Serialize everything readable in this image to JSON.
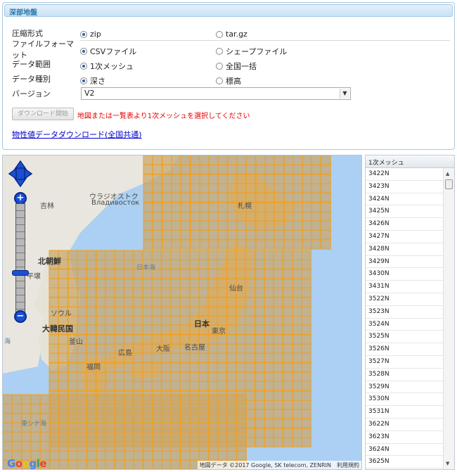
{
  "panel": {
    "title": "深部地盤",
    "rows": [
      {
        "label": "圧縮形式",
        "opt1": "zip",
        "opt2": "tar.gz"
      },
      {
        "label": "ファイルフォーマット",
        "opt1": "CSVファイル",
        "opt2": "シェープファイル"
      },
      {
        "label": "データ範囲",
        "opt1": "1次メッシュ",
        "opt2": "全国一括"
      },
      {
        "label": "データ種別",
        "opt1": "深さ",
        "opt2": "標高"
      }
    ],
    "version_label": "バージョン",
    "version_value": "V2",
    "download_button": "ダウンロード開始",
    "warning": "地図または一覧表より1次メッシュを選択してください",
    "property_link": "物性値データダウンロード(全国共通)"
  },
  "map": {
    "labels": {
      "jilin": "吉林",
      "vladivostok_ja": "ウラジオストク",
      "vladivostok_ru": "Владивосток",
      "north_korea": "北朝鮮",
      "pyongyang": "平壌",
      "seoul": "ソウル",
      "south_korea": "大韓民国",
      "busan": "釜山",
      "sea_of_japan": "日本海",
      "sapporo": "札幌",
      "sendai": "仙台",
      "japan": "日本",
      "tokyo": "東京",
      "nagoya": "名古屋",
      "osaka": "大阪",
      "hiroshima": "広島",
      "fukuoka": "福岡",
      "east_china_sea": "東シナ海",
      "yellow_sea_partial": "海"
    },
    "google_letters": [
      "G",
      "o",
      "o",
      "g",
      "l",
      "e"
    ],
    "google_colors": [
      "#4285f4",
      "#ea4335",
      "#fbbc05",
      "#4285f4",
      "#34a853",
      "#ea4335"
    ],
    "attribution": "地図データ ©2017 Google, SK telecom, ZENRIN",
    "terms": "利用規約",
    "mesh_fill": "#c8a66c",
    "mesh_line": "#f0a020"
  },
  "mesh_list": {
    "header": "1次メッシュ",
    "items": [
      "3422N",
      "3423N",
      "3424N",
      "3425N",
      "3426N",
      "3427N",
      "3428N",
      "3429N",
      "3430N",
      "3431N",
      "3522N",
      "3523N",
      "3524N",
      "3525N",
      "3526N",
      "3527N",
      "3528N",
      "3529N",
      "3530N",
      "3531N",
      "3622N",
      "3623N",
      "3624N",
      "3625N"
    ]
  }
}
